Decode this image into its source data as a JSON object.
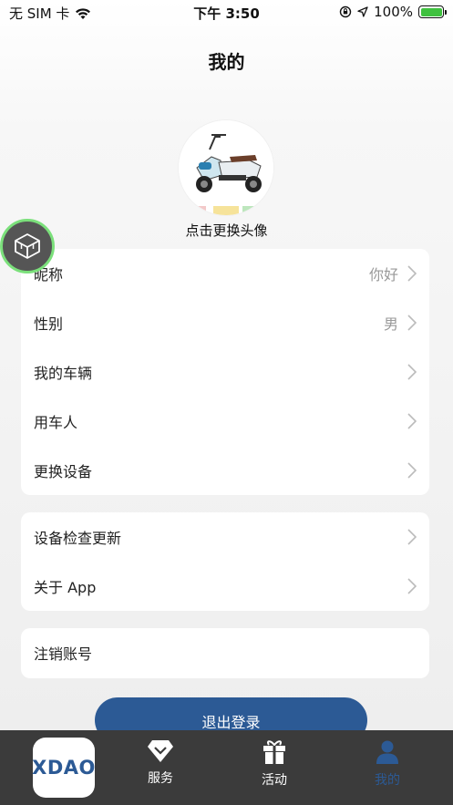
{
  "status_bar": {
    "carrier": "无 SIM 卡",
    "time": "下午 3:50",
    "battery": "100%",
    "battery_level": 1.0
  },
  "page_title": "我的",
  "avatar": {
    "caption": "点击更换头像"
  },
  "profile_card": {
    "rows": [
      {
        "label": "昵称",
        "value": "你好"
      },
      {
        "label": "性别",
        "value": "男"
      },
      {
        "label": "我的车辆",
        "value": ""
      },
      {
        "label": "用车人",
        "value": ""
      },
      {
        "label": "更换设备",
        "value": ""
      }
    ]
  },
  "app_card": {
    "rows": [
      {
        "label": "设备检查更新"
      },
      {
        "label": "关于 App"
      }
    ]
  },
  "account_card": {
    "cancel_account": "注销账号"
  },
  "logout_button": "退出登录",
  "tab_bar": {
    "logo_text": "XDAO",
    "tabs": [
      {
        "label": "服务",
        "icon": "diamond-icon"
      },
      {
        "label": "活动",
        "icon": "gift-icon"
      },
      {
        "label": "我的",
        "icon": "person-icon",
        "active": true
      }
    ]
  },
  "colors": {
    "accent": "#2c5a95",
    "tab_bar_bg": "#3b3b3b",
    "float_border": "#7be07b"
  }
}
